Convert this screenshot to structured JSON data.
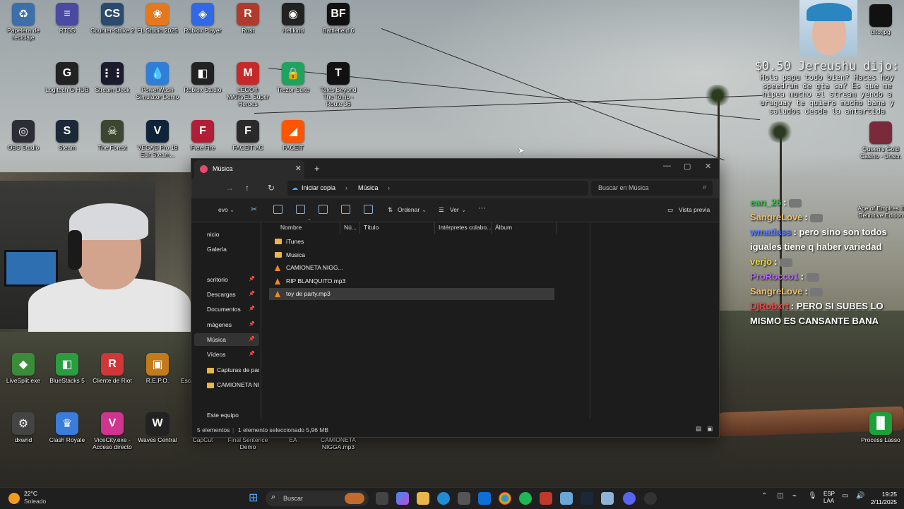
{
  "desktop": {
    "icons": [
      {
        "label": "Papelera de reciclaje",
        "glyph": "♻",
        "color": "#3d6fa8"
      },
      {
        "label": "RTSS",
        "glyph": "≡",
        "color": "#4a4aa0"
      },
      {
        "label": "Counter-Strike 2",
        "glyph": "CS",
        "color": "#2a4b6e"
      },
      {
        "label": "FL Studio 2025",
        "glyph": "❀",
        "color": "#e4781e"
      },
      {
        "label": "Roblox Player",
        "glyph": "◈",
        "color": "#3068e6"
      },
      {
        "label": "Rust",
        "glyph": "R",
        "color": "#b13a2e"
      },
      {
        "label": "Hellkind",
        "glyph": "◉",
        "color": "#222"
      },
      {
        "label": "Battlefield 6",
        "glyph": "BF",
        "color": "#111"
      },
      {
        "label": "Logitech G HUB",
        "glyph": "G",
        "color": "#222"
      },
      {
        "label": "Stream Deck",
        "glyph": "⋮⋮",
        "color": "#1b1b2e"
      },
      {
        "label": "PowerWash Simulator Demo",
        "glyph": "💧",
        "color": "#2f7fd6"
      },
      {
        "label": "Roblox Studio",
        "glyph": "◧",
        "color": "#222"
      },
      {
        "label": "LEGO® MARVEL Super Heroes",
        "glyph": "M",
        "color": "#c42a2a"
      },
      {
        "label": "Trezor Suite",
        "glyph": "🔒",
        "color": "#1fa35f"
      },
      {
        "label": "Tales Beyond The Tomb - Route 36",
        "glyph": "T",
        "color": "#111"
      },
      {
        "label": "OBS Studio",
        "glyph": "◎",
        "color": "#2d2d35"
      },
      {
        "label": "Steam",
        "glyph": "S",
        "color": "#1b2838"
      },
      {
        "label": "The Forest",
        "glyph": "☠",
        "color": "#3d4630"
      },
      {
        "label": "VEGAS Pro 18 Edit Steam...",
        "glyph": "V",
        "color": "#0f2438"
      },
      {
        "label": "Free Fire",
        "glyph": "F",
        "color": "#b01f35"
      },
      {
        "label": "FACEIT AC",
        "glyph": "F",
        "color": "#2a2a2a"
      },
      {
        "label": "FACEIT",
        "glyph": "◢",
        "color": "#ff5500"
      },
      {
        "label": "LiveSplit.exe",
        "glyph": "◆",
        "color": "#3a8c3a"
      },
      {
        "label": "BlueStacks 5",
        "glyph": "◧",
        "color": "#2a9d3f"
      },
      {
        "label": "Cliente de Riot",
        "glyph": "R",
        "color": "#d13639"
      },
      {
        "label": "R.E.P.O.",
        "glyph": "▣",
        "color": "#c27a1a"
      },
      {
        "label": "dxwnd",
        "glyph": "⚙",
        "color": "#444"
      },
      {
        "label": "Clash Royale",
        "glyph": "♛",
        "color": "#3b7bd9"
      },
      {
        "label": "ViceCity.exe - Acceso directo",
        "glyph": "V",
        "color": "#d0348e"
      },
      {
        "label": "Waves Central",
        "glyph": "W",
        "color": "#222"
      },
      {
        "label": "CapCut",
        "glyph": "",
        "color": "transparent"
      },
      {
        "label": "Final Sentence Demo",
        "glyph": "",
        "color": "transparent"
      },
      {
        "label": "EA",
        "glyph": "",
        "color": "transparent"
      },
      {
        "label": "CAMIONETA NIGGA.mp3",
        "glyph": "",
        "color": "transparent"
      },
      {
        "label": "Process Lasso",
        "glyph": "▐▌",
        "color": "#1aa23a"
      },
      {
        "label": "bito.jpg",
        "glyph": "",
        "color": "#111"
      },
      {
        "label": "Queen's Gold Casino - Unscr.",
        "glyph": "",
        "color": "#7a2a3a"
      },
      {
        "label": "Age of Empires II Definitive Edition",
        "glyph": "",
        "color": "transparent"
      },
      {
        "label": "Esc",
        "glyph": "",
        "color": "transparent"
      }
    ]
  },
  "donation": {
    "amount": "$0.50 Jereushu dijo:",
    "message": "Hola papu todo bien? Haces hoy speedrun de gta sa? Es que me hipea mucho el stream yendo a uruguay te quiero mucho bana y saludos desde la antartida"
  },
  "chat": [
    {
      "user": "ean_26",
      "text": "",
      "color": "#3fc65a",
      "emote": true
    },
    {
      "user": "SangreLove",
      "text": "",
      "color": "#f0c06c",
      "emote": true
    },
    {
      "user": "wmatiass",
      "text": "pero sino son todos iguales tiene q haber variedad",
      "color": "#5a7cf0",
      "emote": false
    },
    {
      "user": "verjo",
      "text": "",
      "color": "#e6d84a",
      "emote": true
    },
    {
      "user": "ProRocco1",
      "text": "",
      "color": "#b36cf0",
      "emote": true
    },
    {
      "user": "SangreLove",
      "text": "",
      "color": "#f0c06c",
      "emote": true
    },
    {
      "user": "DjRobxrt",
      "text": "PERO SI SUBES LO MISMO ES CANSANTE BANA",
      "color": "#e84b4b",
      "emote": false
    }
  ],
  "explorer": {
    "tab_title": "Música",
    "new_tab": "+",
    "breadcrumb": [
      "Iniciar copia",
      "Música"
    ],
    "search_placeholder": "Buscar en Música",
    "toolbar": {
      "new": "evo",
      "sort": "Ordenar",
      "view": "Ver",
      "more": "···",
      "preview": "Vista previa"
    },
    "sidebar": [
      {
        "label": "nicio",
        "pin": false,
        "folder": false
      },
      {
        "label": "Galería",
        "pin": false,
        "folder": false
      },
      {
        "label": "scritorio",
        "pin": true,
        "folder": false
      },
      {
        "label": "Descargas",
        "pin": true,
        "folder": false
      },
      {
        "label": "Documentos",
        "pin": true,
        "folder": false
      },
      {
        "label": "mágenes",
        "pin": true,
        "folder": false
      },
      {
        "label": "Música",
        "pin": true,
        "folder": false,
        "selected": true
      },
      {
        "label": "Vídeos",
        "pin": true,
        "folder": false
      },
      {
        "label": "Capturas de pan",
        "pin": false,
        "folder": true
      },
      {
        "label": "CAMIONETA NI",
        "pin": false,
        "folder": true
      },
      {
        "label": "Este equipo",
        "pin": false,
        "folder": false
      }
    ],
    "columns": [
      "Nombre",
      "Nú...",
      "Título",
      "Intérpretes colabo...",
      "Álbum"
    ],
    "files": [
      {
        "name": "iTunes",
        "type": "folder",
        "selected": false
      },
      {
        "name": "Musica",
        "type": "folder",
        "selected": false
      },
      {
        "name": "CAMIONETA NIGG...",
        "type": "mp3",
        "selected": false
      },
      {
        "name": "RIP BLANQUITO.mp3",
        "type": "mp3",
        "selected": false
      },
      {
        "name": "toy de party.mp3",
        "type": "mp3",
        "selected": true
      }
    ],
    "status": {
      "count": "5 elementos",
      "selection": "1 elemento seleccionado  5,96 MB"
    }
  },
  "taskbar": {
    "weather_temp": "22°C",
    "weather_desc": "Soleado",
    "search_label": "Buscar",
    "lang": "ESP",
    "lang_sub": "LAA",
    "time": "19:25",
    "date": "2/11/2025"
  }
}
